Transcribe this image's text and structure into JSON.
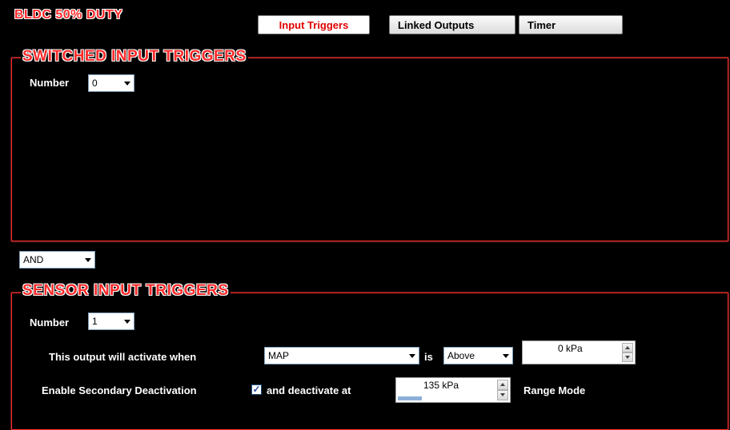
{
  "header": {
    "title": "BLDC 50% DUTY",
    "tabs": [
      {
        "label": "Input Triggers",
        "active": true
      },
      {
        "label": "Linked Outputs",
        "active": false
      },
      {
        "label": "Timer",
        "active": false
      }
    ]
  },
  "switched": {
    "title": "SWITCHED INPUT TRIGGERS",
    "number_label": "Number",
    "number_value": "0"
  },
  "logic": {
    "value": "AND"
  },
  "sensor": {
    "title": "SENSOR INPUT TRIGGERS",
    "number_label": "Number",
    "number_value": "1",
    "activate_label": "This output will activate when",
    "sensor_value": "MAP",
    "is_label": "is",
    "comparison_value": "Above",
    "threshold_value": "0 kPa",
    "secondary_label": "Enable Secondary Deactivation",
    "secondary_checked": true,
    "deactivate_label": "and deactivate at",
    "deactivate_value": "135 kPa",
    "range_mode_label": "Range Mode"
  },
  "colors": {
    "accent": "#ff2a2a",
    "background": "#000000"
  }
}
